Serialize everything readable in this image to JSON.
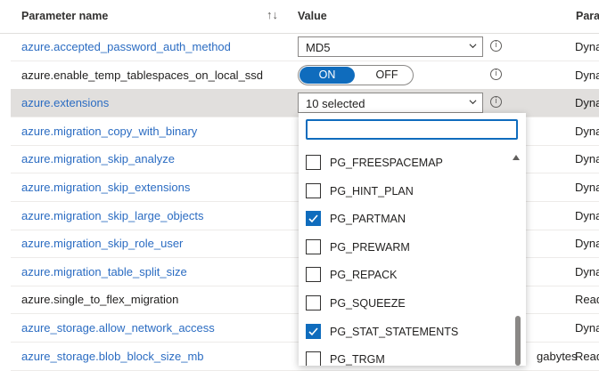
{
  "header": {
    "param_name": "Parameter name",
    "value": "Value",
    "type_cut": "Para"
  },
  "rows": [
    {
      "name": "azure.accepted_password_auth_method",
      "link": true,
      "type": "Dyna",
      "control": "select",
      "value": "MD5"
    },
    {
      "name": "azure.enable_temp_tablespaces_on_local_ssd",
      "link": false,
      "type": "Dyna",
      "control": "toggle",
      "on": "ON",
      "off": "OFF"
    },
    {
      "name": "azure.extensions",
      "link": true,
      "type": "Dyna",
      "control": "select",
      "value": "10 selected"
    },
    {
      "name": "azure.migration_copy_with_binary",
      "link": true,
      "type": "Dyna"
    },
    {
      "name": "azure.migration_skip_analyze",
      "link": true,
      "type": "Dyna"
    },
    {
      "name": "azure.migration_skip_extensions",
      "link": true,
      "type": "Dyna"
    },
    {
      "name": "azure.migration_skip_large_objects",
      "link": true,
      "type": "Dyna"
    },
    {
      "name": "azure.migration_skip_role_user",
      "link": true,
      "type": "Dyna"
    },
    {
      "name": "azure.migration_table_split_size",
      "link": true,
      "type": "Dyna"
    },
    {
      "name": "azure.single_to_flex_migration",
      "link": false,
      "type": "Read"
    },
    {
      "name": "azure_storage.allow_network_access",
      "link": true,
      "type": "Dyna"
    },
    {
      "name": "azure_storage.blob_block_size_mb",
      "link": true,
      "type": "Read",
      "value_cut": "gabytes"
    }
  ],
  "dropdown": {
    "search_value": "",
    "items": [
      {
        "label": "PG_FREESPACEMAP",
        "checked": false
      },
      {
        "label": "PG_HINT_PLAN",
        "checked": false
      },
      {
        "label": "PG_PARTMAN",
        "checked": true
      },
      {
        "label": "PG_PREWARM",
        "checked": false
      },
      {
        "label": "PG_REPACK",
        "checked": false
      },
      {
        "label": "PG_SQUEEZE",
        "checked": false
      },
      {
        "label": "PG_STAT_STATEMENTS",
        "checked": true
      },
      {
        "label": "PG_TRGM",
        "checked": false
      }
    ]
  },
  "colors": {
    "accent": "#0f6cbd",
    "link": "#2b6cc2",
    "selected_row": "#e1dfdd"
  },
  "icons": {
    "info": "info-icon",
    "sort": "sort-icon",
    "chevron": "chevron-down-icon",
    "check": "checkmark-icon"
  }
}
